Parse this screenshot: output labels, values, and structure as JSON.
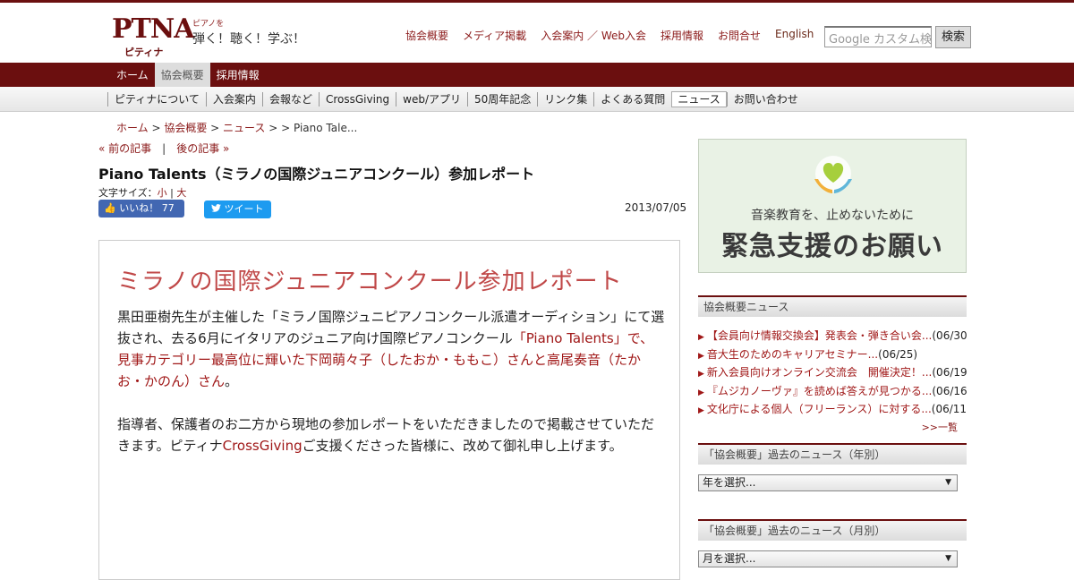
{
  "header": {
    "logo_text": "PTNA",
    "logo_sub": "ピティナ",
    "tagline_small": "ピアノを",
    "tagline_main": "弾く！聴く！学ぶ！",
    "nav": [
      "協会概要",
      "メディア掲載",
      "入会案内 ／ Web入会",
      "採用情報",
      "お問合せ"
    ],
    "nav_en": "English",
    "search_placeholder": "Google カスタム検索",
    "search_button": "検索"
  },
  "mainnav": [
    "ホーム",
    "協会概要",
    "採用情報"
  ],
  "subnav": [
    "ピティナについて",
    "入会案内",
    "会報など",
    "CrossGiving",
    "web/アプリ",
    "50周年記念",
    "リンク集",
    "よくある質問",
    "ニュース",
    "お問い合わせ"
  ],
  "breadcrumb": {
    "home": "ホーム",
    "sep1": " > ",
    "cat": "協会概要",
    "sep2": " > ",
    "news": "ニュース",
    "rest": " > > Piano Tale..."
  },
  "pager": {
    "prev": "« 前の記事",
    "sep": "|",
    "next": "後の記事 »"
  },
  "article": {
    "title": "Piano Talents（ミラノの国際ジュニアコンクール）参加レポート",
    "fontsize_label": "文字サイズ：",
    "fontsize_small": "小",
    "fontsize_sep": " | ",
    "fontsize_large": "大",
    "like_label": "いいね！",
    "like_count": "77",
    "tweet_label": "ツイート",
    "date": "2013/07/05",
    "heading": "ミラノの国際ジュニアコンクール参加レポート",
    "p1_a": "黒田亜樹先生が主催した「ミラノ国際ジュニピアノコンクール派遣オーディション」にて選抜され、去る6月にイタリアのジュニア向け国際ピアノコンクール",
    "p1_link": "「Piano Talents」で、見事カテゴリー最高位に輝いた下岡萌々子（したおか・ももこ）さんと高尾奏音（たかお・かのん）さん",
    "p1_b": "。",
    "p2_a": "指導者、保護者のお二方から現地の参加レポートをいただきましたので掲載させていただきます。ピティナ",
    "p2_link": "CrossGiving",
    "p2_b": "ご支援くださった皆様に、改めて御礼申し上げます。"
  },
  "banner": {
    "sub": "音楽教育を、止めないために",
    "main": "緊急支援のお願い"
  },
  "sidebar": {
    "news_heading": "協会概要ニュース",
    "news": [
      {
        "title": "【会員向け情報交換会】発表会・弾き合い会...",
        "date": "(06/30)"
      },
      {
        "title": "音大生のためのキャリアセミナー...",
        "date": "(06/25)"
      },
      {
        "title": "新入会員向けオンライン交流会　開催決定！...",
        "date": "(06/19)"
      },
      {
        "title": "『ムジカノーヴァ』を読めば答えが見つかる...",
        "date": "(06/16)"
      },
      {
        "title": "文化庁による個人（フリーランス）に対する...",
        "date": "(06/11)"
      }
    ],
    "more": ">>一覧",
    "year_heading": "「協会概要」過去のニュース（年別）",
    "year_select": "年を選択...",
    "month_heading": "「協会概要」過去のニュース（月別）",
    "month_select": "月を選択..."
  },
  "colors": {
    "brand": "#6b0f0f",
    "link": "#a01818",
    "heading": "#c04848",
    "facebook": "#4267b2",
    "twitter": "#1d9bf0"
  }
}
